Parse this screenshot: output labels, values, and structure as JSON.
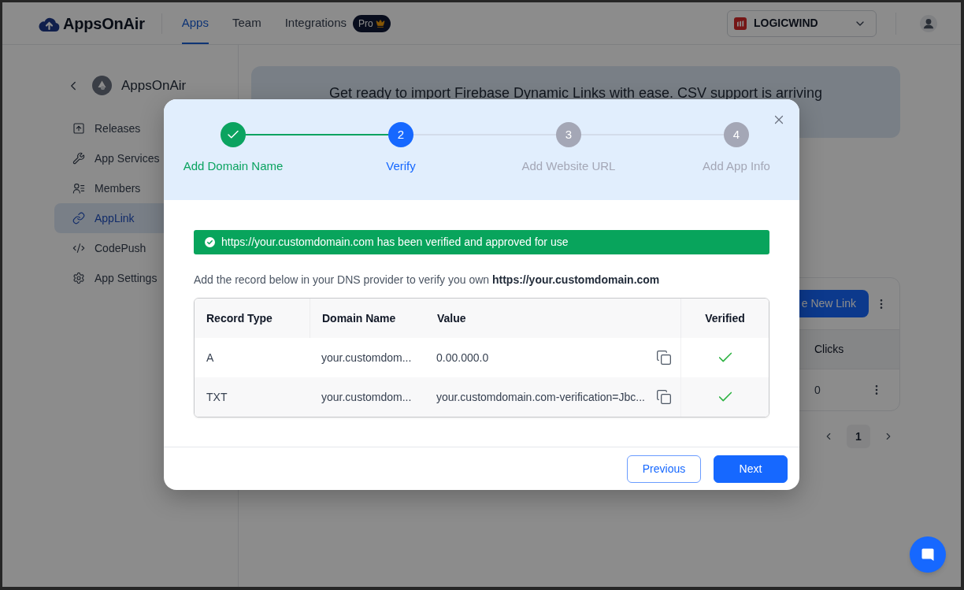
{
  "nav": {
    "logo": "AppsOnAir",
    "tabs": [
      {
        "label": "Apps",
        "selected": true
      },
      {
        "label": "Team",
        "selected": false
      },
      {
        "label": "Integrations",
        "selected": false,
        "badge": "Pro"
      }
    ],
    "workspace": "LOGICWIND"
  },
  "sidebar": {
    "app_name": "AppsOnAir",
    "items": [
      {
        "label": "Releases",
        "selected": false
      },
      {
        "label": "App Services",
        "selected": false
      },
      {
        "label": "Members",
        "selected": false
      },
      {
        "label": "AppLink",
        "selected": true
      },
      {
        "label": "CodePush",
        "selected": false
      },
      {
        "label": "App Settings",
        "selected": false
      }
    ]
  },
  "banner": {
    "text": "Get ready to import Firebase Dynamic Links with ease. CSV support is arriving"
  },
  "links_card": {
    "button": "e New Link",
    "columns": [
      "Clicks"
    ],
    "rows": [
      [
        "0"
      ]
    ]
  },
  "pagination": {
    "pages": [
      {
        "label": "1",
        "selected": true
      }
    ]
  },
  "modal": {
    "steps": [
      {
        "label": "Add Domain Name",
        "completed": true,
        "selected": false
      },
      {
        "number": "2",
        "label": "Verify",
        "completed": false,
        "selected": true
      },
      {
        "number": "3",
        "label": "Add Website URL",
        "completed": false,
        "selected": false
      },
      {
        "number": "4",
        "label": "Add App Info",
        "completed": false,
        "selected": false
      }
    ],
    "alert": {
      "kind": "success",
      "text": "https://your.customdomain.com has been verified and approved for use"
    },
    "instruction": "Add the record below in your DNS provider to verify you own **https://your.customdomain.com**",
    "table": {
      "columns": [
        "Record Type",
        "Domain Name",
        "Value",
        "Verified"
      ],
      "rows": [
        {
          "record_type": "A",
          "domain_name": "your.customdom...",
          "value": "0.00.000.0",
          "verified": true
        },
        {
          "record_type": "TXT",
          "domain_name": "your.customdom...",
          "value": "your.customdomain.com-verification=Jbc...",
          "verified": true
        }
      ]
    },
    "buttons": [
      {
        "label": "Previous",
        "kind": "secondary"
      },
      {
        "label": "Next",
        "kind": "primary"
      }
    ]
  }
}
